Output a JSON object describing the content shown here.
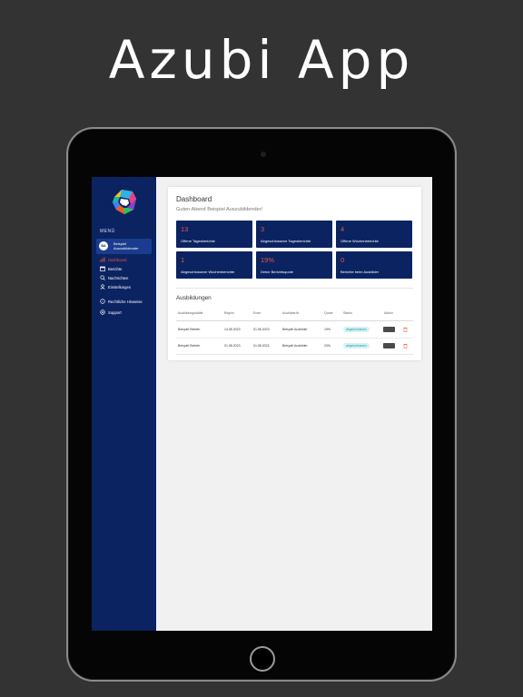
{
  "hero": {
    "title": "Azubi App"
  },
  "sidebar": {
    "menu_title": "MENÜ",
    "user": {
      "initials": "BA",
      "name": "Beispiel Auszubildender"
    },
    "items": [
      {
        "label": "Dashboard",
        "icon": "chart-icon",
        "active": true
      },
      {
        "label": "Berichte",
        "icon": "calendar-icon",
        "active": false
      },
      {
        "label": "Nachrichten",
        "icon": "messages-icon",
        "active": false
      },
      {
        "label": "Einstellungen",
        "icon": "user-settings-icon",
        "active": false
      },
      {
        "label": "Rechtliche Hinweise",
        "icon": "info-icon",
        "active": false
      },
      {
        "label": "Support",
        "icon": "support-icon",
        "active": false
      }
    ]
  },
  "dashboard": {
    "title": "Dashboard",
    "greeting": "Guten Abend Beispiel Auszubildender!",
    "stats": [
      {
        "value": "13",
        "label": "Offene Tagesberichte"
      },
      {
        "value": "3",
        "label": "Abgeschlossene Tagesberichte"
      },
      {
        "value": "4",
        "label": "Offene Wochenberichte"
      },
      {
        "value": "1",
        "label": "Abgeschlossene Wochenberichte"
      },
      {
        "value": "19%",
        "label": "Deine Berichtsquote"
      },
      {
        "value": "0",
        "label": "Berichte beim Ausbilder"
      }
    ]
  },
  "ausbildungen": {
    "title": "Ausbildungen",
    "columns": [
      "Ausbildungsstätte",
      "Beginn",
      "Ende",
      "Ausbilder/in",
      "Quote",
      "Status",
      "Aktion"
    ],
    "rows": [
      {
        "stätte": "Beispiel Betrieb",
        "beginn": "14.08.2023",
        "ende": "01.08.2023",
        "ausbilder": "Beispiel Ausbilder",
        "quote": "19%",
        "status": "abgeschlossen"
      },
      {
        "stätte": "Beispiel Betrieb",
        "beginn": "01.08.2023",
        "ende": "01.08.2023",
        "ausbilder": "Beispiel Ausbilder",
        "quote": "20%",
        "status": "abgeschlossen"
      }
    ]
  },
  "colors": {
    "navy": "#0c2362",
    "accent": "#e2563b",
    "background": "#333333",
    "status_bg": "#d6f2f4",
    "status_text": "#18a0ae"
  }
}
